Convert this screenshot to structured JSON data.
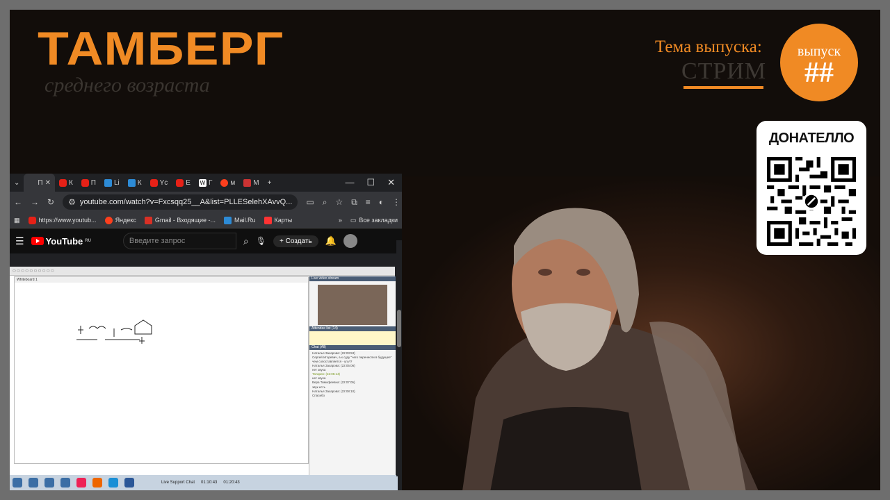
{
  "brand": {
    "title": "ТАМБЕРГ",
    "subtitle": "среднего возраста"
  },
  "episode": {
    "label": "Тема выпуска:",
    "topic": "СТРИМ",
    "badge_label": "выпуск",
    "badge_number": "##"
  },
  "donation": {
    "title": "ДОНАТЕЛЛО"
  },
  "browser": {
    "tabs": [
      {
        "label": "П",
        "icon": "generic"
      },
      {
        "label": "К",
        "icon": "youtube"
      },
      {
        "label": "П",
        "icon": "youtube"
      },
      {
        "label": "Li",
        "icon": "blue"
      },
      {
        "label": "К",
        "icon": "blue"
      },
      {
        "label": "Yc",
        "icon": "youtube"
      },
      {
        "label": "Е",
        "icon": "youtube"
      },
      {
        "label": "Г",
        "icon": "w"
      },
      {
        "label": "м",
        "icon": "yandex"
      },
      {
        "label": "М",
        "icon": "calendar"
      }
    ],
    "url": "youtube.com/watch?v=Fxcsqq25__A&list=PLLESelehXAvvQ...",
    "bookmarks": [
      "https://www.youtub...",
      "Яндекс",
      "Gmail - Входящие -...",
      "Mail.Ru",
      "Карты"
    ],
    "all_bookmarks": "Все закладки",
    "youtube": {
      "logo": "YouTube",
      "region": "RU",
      "search_placeholder": "Введите запрос",
      "create_label": "Создать"
    }
  },
  "video": {
    "whiteboard_title": "Whiteboard 1",
    "panel_live": "Live video stream",
    "panel_attendees": "Attendee list (14)",
    "panel_chat": "Chat (All)",
    "chat_lines": [
      "Наталья Захарова: (22:03:53)",
      "Сергей Игоревич, а к суду \"чего перенесли в будущее\" чем сопоставляется - угол?",
      "Наталья Захарова: (22:05:06)",
      "нет звука",
      "Татарин: (22:05:14)",
      "нет звука",
      "Вера Тимофеевна: (22:07:05)",
      "звук есть",
      "Наталья Захарова: (22:08:10)",
      "Спасибо"
    ],
    "taskbar_status": "Live Support Chat",
    "timer": "01:10:43",
    "elapsed": "01:20:43"
  }
}
